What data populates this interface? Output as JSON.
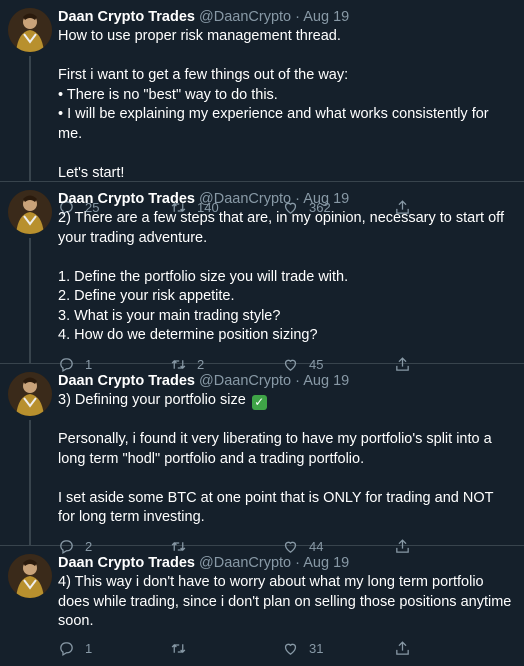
{
  "tweets": [
    {
      "name": "Daan Crypto Trades",
      "handle": "@DaanCrypto",
      "date": "Aug 19",
      "lines": [
        "How to use proper risk management thread.",
        "",
        "First i want to get a few things out of the way:",
        "• There is no \"best\" way to do this.",
        "• I will be explaining my experience and what works consistently for me.",
        "",
        "Let's start!"
      ],
      "replies": "25",
      "retweets": "140",
      "likes": "362"
    },
    {
      "name": "Daan Crypto Trades",
      "handle": "@DaanCrypto",
      "date": "Aug 19",
      "lines": [
        "2) There are a few steps that are, in my opinion, necessary to start off your trading adventure.",
        "",
        "1. Define the portfolio size you will trade with.",
        "2. Define your risk appetite.",
        "3. What is your main trading style?",
        "4. How do we determine position sizing?"
      ],
      "replies": "1",
      "retweets": "2",
      "likes": "45"
    },
    {
      "name": "Daan Crypto Trades",
      "handle": "@DaanCrypto",
      "date": "Aug 19",
      "lines": [
        "3) Defining your portfolio size",
        "",
        "Personally, i found it very liberating to have my portfolio's split into a long term \"hodl\" portfolio and a trading portfolio.",
        "",
        "I set aside some BTC at one point that is ONLY for trading and NOT for long term investing."
      ],
      "replies": "2",
      "retweets": "",
      "likes": "44"
    },
    {
      "name": "Daan Crypto Trades",
      "handle": "@DaanCrypto",
      "date": "Aug 19",
      "lines": [
        "4) This way i don't have to worry about what my long term portfolio does while trading, since i don't plan on selling those positions anytime soon."
      ],
      "replies": "1",
      "retweets": "",
      "likes": "31"
    }
  ],
  "colors": {
    "background": "#15202b",
    "muted": "#8899a6",
    "divider": "#38444d"
  },
  "icons": {
    "reply": "reply-icon",
    "retweet": "retweet-icon",
    "like": "heart-icon",
    "share": "share-icon",
    "check": "check-mark-icon"
  }
}
